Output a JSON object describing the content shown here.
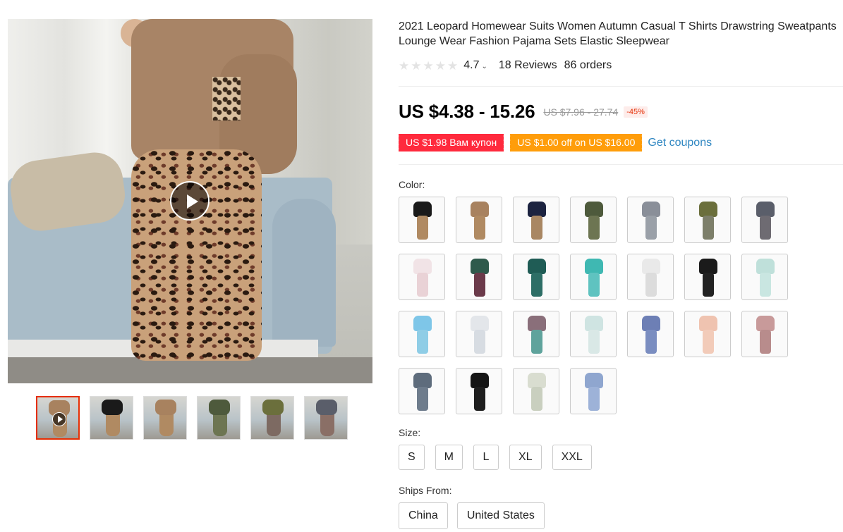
{
  "product": {
    "title": "2021 Leopard Homewear Suits Women Autumn Casual T Shirts Drawstring Sweatpants Lounge Wear Fashion Pajama Sets Elastic Sleepwear",
    "rating": "4.7",
    "reviews": "18 Reviews",
    "orders": "86 orders",
    "stars_filled": 0,
    "stars_total": 5
  },
  "price": {
    "current": "US $4.38 - 15.26",
    "original": "US $7.96 - 27.74",
    "discount": "-45%"
  },
  "coupons": {
    "coupon1": "US $1.98 Вам купон",
    "coupon2": "US $1.00 off on US $16.00",
    "get_coupons": "Get coupons"
  },
  "labels": {
    "color": "Color:",
    "size": "Size:",
    "ships_from": "Ships From:"
  },
  "colors": [
    {
      "top": "#1a1a1a",
      "bottom": "#b08a62"
    },
    {
      "top": "#a8825f",
      "bottom": "#b08a62"
    },
    {
      "top": "#1c2340",
      "bottom": "#a98763"
    },
    {
      "top": "#4e5a3c",
      "bottom": "#6d7552"
    },
    {
      "top": "#8a8f99",
      "bottom": "#9aa0a8"
    },
    {
      "top": "#6b6f3c",
      "bottom": "#7d7f6a"
    },
    {
      "top": "#5a5e6a",
      "bottom": "#6e6b72"
    },
    {
      "top": "#f1e3e6",
      "bottom": "#e9d2d6"
    },
    {
      "top": "#2f5a4c",
      "bottom": "#6b3a4a"
    },
    {
      "top": "#1f5c55",
      "bottom": "#2d6e66"
    },
    {
      "top": "#3fb8b2",
      "bottom": "#5fc3c0"
    },
    {
      "top": "#e9e9e9",
      "bottom": "#dcdcdc"
    },
    {
      "top": "#1b1b1b",
      "bottom": "#222222"
    },
    {
      "top": "#bfe0da",
      "bottom": "#c9e6e1"
    },
    {
      "top": "#7ec6e8",
      "bottom": "#8fcde6"
    },
    {
      "top": "#e3e6ea",
      "bottom": "#d7dce2"
    },
    {
      "top": "#8a6f7a",
      "bottom": "#5fa39c"
    },
    {
      "top": "#cfe4e2",
      "bottom": "#d9e8e6"
    },
    {
      "top": "#6d7fb5",
      "bottom": "#7a8dc0"
    },
    {
      "top": "#efc3b0",
      "bottom": "#f2cbb9"
    },
    {
      "top": "#c89a9a",
      "bottom": "#b88c8c"
    },
    {
      "top": "#5e6c7c",
      "bottom": "#6e7c8c"
    },
    {
      "top": "#151515",
      "bottom": "#1e1e1e"
    },
    {
      "top": "#d9ddd0",
      "bottom": "#c9cfbf"
    },
    {
      "top": "#8fa6cf",
      "bottom": "#9db2d8"
    }
  ],
  "sizes": [
    "S",
    "M",
    "L",
    "XL",
    "XXL"
  ],
  "ships_from": [
    "China",
    "United States"
  ],
  "thumbnails": [
    {
      "top": "#a8825f",
      "bottom": "#b08a62",
      "video": true
    },
    {
      "top": "#1a1a1a",
      "bottom": "#b08a62",
      "video": false
    },
    {
      "top": "#a8825f",
      "bottom": "#b08a62",
      "video": false
    },
    {
      "top": "#4e5a3c",
      "bottom": "#6d7552",
      "video": false
    },
    {
      "top": "#6b6f3c",
      "bottom": "#7d6a62",
      "video": false
    },
    {
      "top": "#5a5e6a",
      "bottom": "#8a6f66",
      "video": false
    }
  ],
  "theme": {
    "accent": "#e62e04",
    "coupon_red": "#ff2a3d",
    "coupon_orange": "#ff9d0a",
    "link": "#2e86c1"
  }
}
